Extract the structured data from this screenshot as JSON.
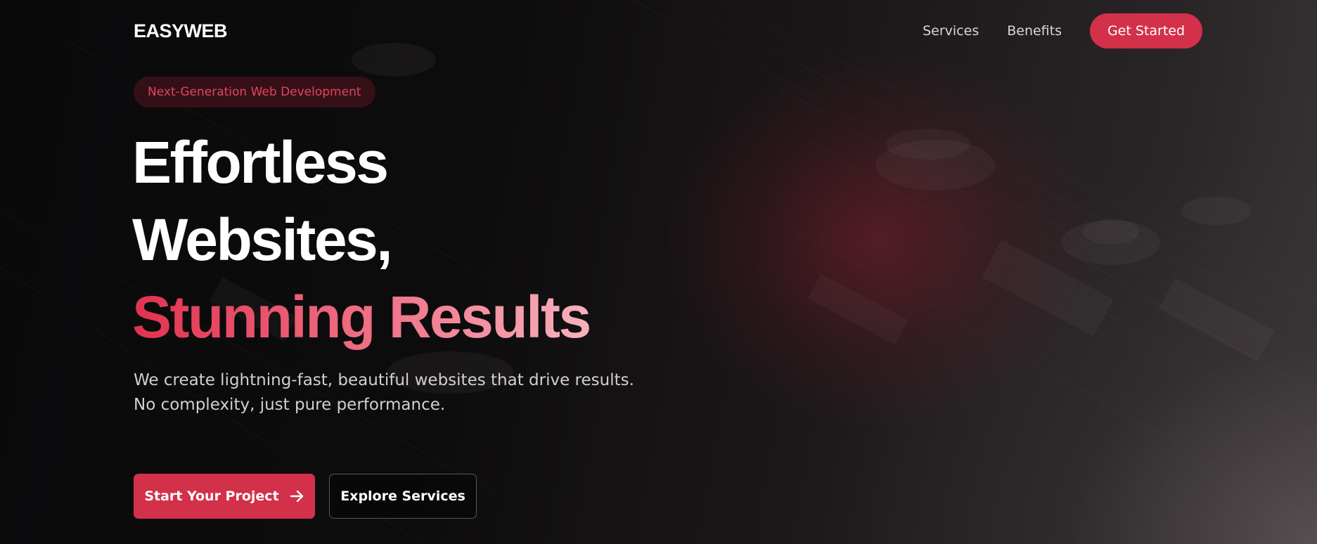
{
  "header": {
    "logo": "EASYWEB",
    "nav": [
      {
        "label": "Services"
      },
      {
        "label": "Benefits"
      }
    ],
    "cta_label": "Get Started"
  },
  "hero": {
    "badge": "Next-Generation Web Development",
    "headline_line1": "Effortless",
    "headline_line2": "Websites,",
    "headline_accent": "Stunning Results",
    "subtext": "We create lightning-fast, beautiful websites that drive results. No complexity, just pure performance.",
    "primary_button": "Start Your Project",
    "secondary_button": "Explore Services"
  },
  "colors": {
    "accent": "#d3304a",
    "background": "#0a0a0b",
    "text": "#ffffff"
  },
  "icons": {
    "primary_button_icon": "arrow-right-icon"
  }
}
